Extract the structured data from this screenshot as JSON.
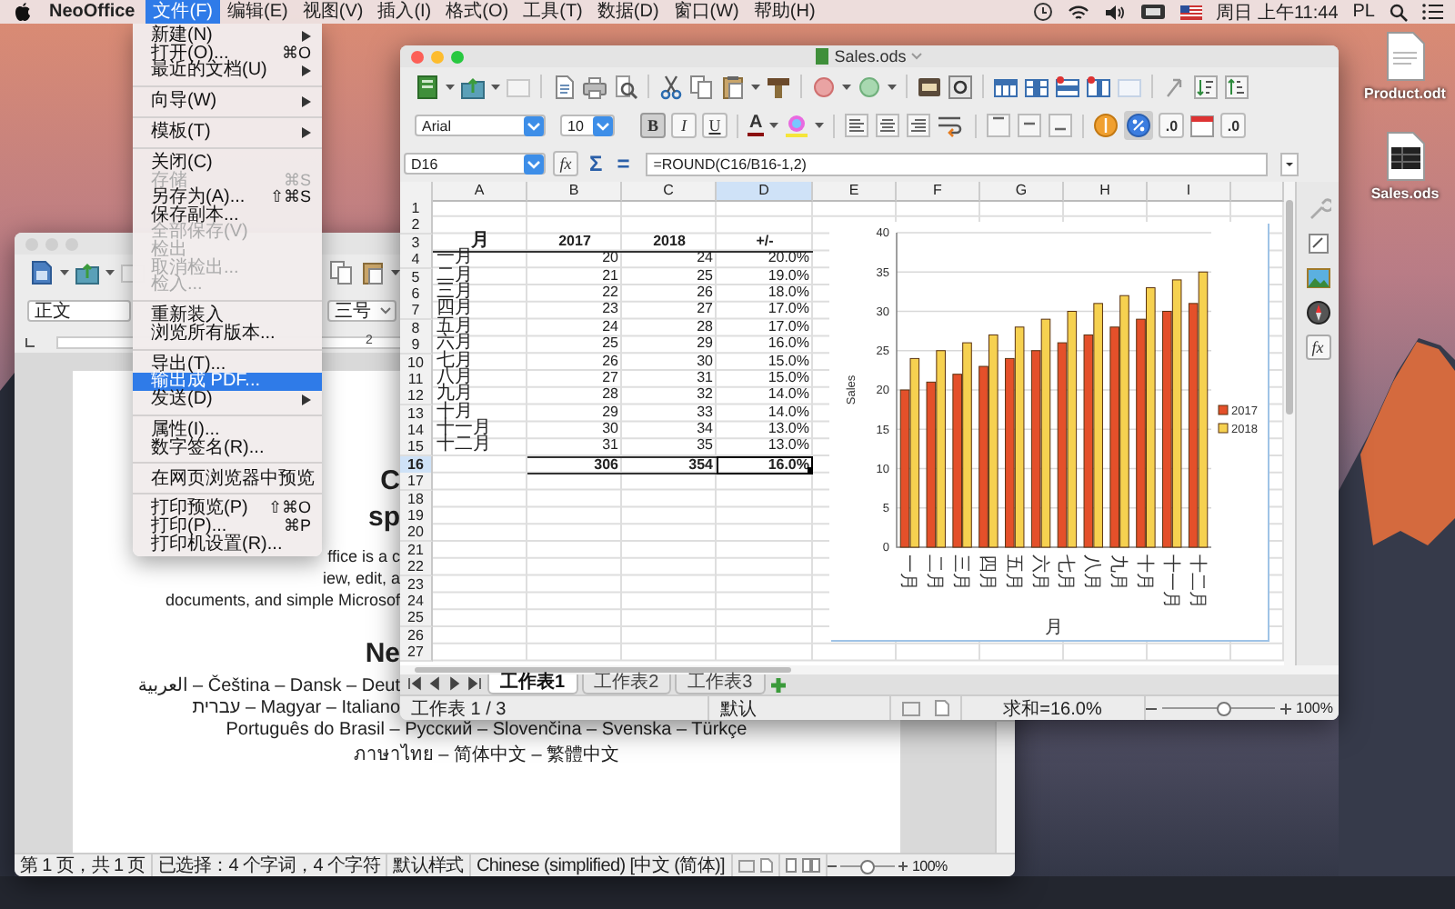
{
  "menubar": {
    "app_name": "NeoOffice",
    "menus": [
      {
        "label": "文件(F)",
        "selected": true
      },
      {
        "label": "编辑(E)",
        "selected": false
      },
      {
        "label": "视图(V)",
        "selected": false
      },
      {
        "label": "插入(I)",
        "selected": false
      },
      {
        "label": "格式(O)",
        "selected": false
      },
      {
        "label": "工具(T)",
        "selected": false
      },
      {
        "label": "数据(D)",
        "selected": false
      },
      {
        "label": "窗口(W)",
        "selected": false
      },
      {
        "label": "帮助(H)",
        "selected": false
      }
    ],
    "clock": "周日 上午11:44",
    "input_source": "PL"
  },
  "desktop_icons": [
    {
      "label": "Product.odt",
      "kind": "document"
    },
    {
      "label": "Sales.ods",
      "kind": "spreadsheet"
    }
  ],
  "writer_window": {
    "paragraph_style": "正文",
    "font_size": "三号",
    "ruler_label": "2",
    "page_lines": [
      {
        "kind": "heading",
        "clipped": true,
        "text": "C"
      },
      {
        "kind": "heading",
        "clipped": true,
        "text": "sp"
      },
      {
        "kind": "body",
        "clipped": true,
        "text": "ffice is a c"
      },
      {
        "kind": "body",
        "clipped": true,
        "text": "iew, edit, a"
      },
      {
        "kind": "body",
        "clipped": true,
        "text": "documents, and simple Microsof"
      },
      {
        "kind": "heading",
        "clipped": true,
        "text": "Ne"
      },
      {
        "kind": "language",
        "clipped": true,
        "text": "العربية – Čeština – Dansk – Deut"
      },
      {
        "kind": "language",
        "clipped": true,
        "text": "עברית – Magyar – Italiano"
      },
      {
        "kind": "language",
        "clipped": false,
        "text": "Português do Brasil – Русский – Slovenčina – Svenska – Türkçe"
      },
      {
        "kind": "language",
        "clipped": false,
        "text": "ภาษาไทย – 简体中文 – 繁體中文"
      }
    ],
    "status_bar": {
      "page": "第 1 页，共 1 页",
      "selection": "已选择：4 个字词，4 个字符",
      "page_style": "默认样式",
      "language": "Chinese (simplified) [中文 (简体)]",
      "zoom": "100%",
      "zoom_slider": {
        "level": 0.5
      }
    }
  },
  "file_menu": {
    "groups": [
      {
        "items": [
          {
            "label": "新建(N)",
            "submenu": true,
            "disabled": false,
            "selected": false
          },
          {
            "label": "打开(O)...",
            "shortcut": "⌘O",
            "submenu": false,
            "disabled": false,
            "selected": false
          },
          {
            "label": "最近的文档(U)",
            "submenu": true,
            "disabled": false,
            "selected": false
          }
        ]
      },
      {
        "items": [
          {
            "label": "向导(W)",
            "submenu": true,
            "disabled": false,
            "selected": false
          }
        ]
      },
      {
        "items": [
          {
            "label": "模板(T)",
            "submenu": true,
            "disabled": false,
            "selected": false
          }
        ]
      },
      {
        "items": [
          {
            "label": "关闭(C)",
            "submenu": false,
            "disabled": false,
            "selected": false
          },
          {
            "label": "存储",
            "shortcut": "⌘S",
            "submenu": false,
            "disabled": true,
            "selected": false
          },
          {
            "label": "另存为(A)...",
            "shortcut": "⇧⌘S",
            "submenu": false,
            "disabled": false,
            "selected": false
          },
          {
            "label": "保存副本...",
            "submenu": false,
            "disabled": false,
            "selected": false
          },
          {
            "label": "全部保存(V)",
            "submenu": false,
            "disabled": true,
            "selected": false
          },
          {
            "label": "检出",
            "submenu": false,
            "disabled": true,
            "selected": false
          },
          {
            "label": "取消检出...",
            "submenu": false,
            "disabled": true,
            "selected": false
          },
          {
            "label": "检入...",
            "submenu": false,
            "disabled": true,
            "selected": false
          }
        ]
      },
      {
        "items": [
          {
            "label": "重新装入",
            "submenu": false,
            "disabled": false,
            "selected": false
          },
          {
            "label": "浏览所有版本...",
            "submenu": false,
            "disabled": false,
            "selected": false
          }
        ]
      },
      {
        "items": [
          {
            "label": "导出(T)...",
            "submenu": false,
            "disabled": false,
            "selected": false
          },
          {
            "label": "输出成 PDF...",
            "submenu": false,
            "disabled": false,
            "selected": true
          },
          {
            "label": "发送(D)",
            "submenu": true,
            "disabled": false,
            "selected": false
          }
        ]
      },
      {
        "items": [
          {
            "label": "属性(I)...",
            "submenu": false,
            "disabled": false,
            "selected": false
          },
          {
            "label": "数字签名(R)...",
            "submenu": false,
            "disabled": false,
            "selected": false
          }
        ]
      },
      {
        "items": [
          {
            "label": "在网页浏览器中预览",
            "submenu": false,
            "disabled": false,
            "selected": false
          }
        ]
      },
      {
        "items": [
          {
            "label": "打印预览(P)",
            "shortcut": "⇧⌘O",
            "submenu": false,
            "disabled": false,
            "selected": false
          },
          {
            "label": "打印(P)...",
            "shortcut": "⌘P",
            "submenu": false,
            "disabled": false,
            "selected": false
          },
          {
            "label": "打印机设置(R)...",
            "submenu": false,
            "disabled": false,
            "selected": false
          }
        ]
      }
    ]
  },
  "spreadsheet_window": {
    "title": "Sales.ods",
    "font_name": "Arial",
    "font_size": "10",
    "format_buttons": [
      {
        "label": "B",
        "kind": "bold",
        "on": true
      },
      {
        "label": "I",
        "kind": "italic",
        "on": false
      },
      {
        "label": "U",
        "kind": "underline",
        "on": false
      }
    ],
    "font_color_label": "A",
    "percent_format_on": true,
    "add_decimal_label": ".0",
    "delete_decimal_label": ".0",
    "name_box": "D16",
    "function_wizard_label": "fx",
    "sum_label": "Σ",
    "equals_label": "=",
    "formula": "=ROUND(C16/B16-1,2)",
    "columns": [
      {
        "label": "A",
        "selected": false
      },
      {
        "label": "B",
        "selected": false
      },
      {
        "label": "C",
        "selected": false
      },
      {
        "label": "D",
        "selected": true
      },
      {
        "label": "E",
        "selected": false
      },
      {
        "label": "F",
        "selected": false
      },
      {
        "label": "G",
        "selected": false
      },
      {
        "label": "H",
        "selected": false
      },
      {
        "label": "I",
        "selected": false
      }
    ],
    "rows": [
      {
        "number": "1",
        "selected": false
      },
      {
        "number": "2",
        "selected": false
      },
      {
        "number": "3",
        "kind": "header",
        "selected": false,
        "a": {
          "text": "月",
          "selected": false
        },
        "b": {
          "text": "2017",
          "selected": false
        },
        "c": {
          "text": "2018",
          "selected": false
        },
        "d": {
          "text": "+/-",
          "selected": false
        }
      },
      {
        "number": "4",
        "kind": "data",
        "selected": false,
        "a": {
          "text": "一月",
          "selected": false
        },
        "b": {
          "text": "20",
          "selected": false
        },
        "c": {
          "text": "24",
          "selected": false
        },
        "d": {
          "text": "20.0%",
          "selected": false
        }
      },
      {
        "number": "5",
        "kind": "data",
        "selected": false,
        "a": {
          "text": "二月",
          "selected": false
        },
        "b": {
          "text": "21",
          "selected": false
        },
        "c": {
          "text": "25",
          "selected": false
        },
        "d": {
          "text": "19.0%",
          "selected": false
        }
      },
      {
        "number": "6",
        "kind": "data",
        "selected": false,
        "a": {
          "text": "三月",
          "selected": false
        },
        "b": {
          "text": "22",
          "selected": false
        },
        "c": {
          "text": "26",
          "selected": false
        },
        "d": {
          "text": "18.0%",
          "selected": false
        }
      },
      {
        "number": "7",
        "kind": "data",
        "selected": false,
        "a": {
          "text": "四月",
          "selected": false
        },
        "b": {
          "text": "23",
          "selected": false
        },
        "c": {
          "text": "27",
          "selected": false
        },
        "d": {
          "text": "17.0%",
          "selected": false
        }
      },
      {
        "number": "8",
        "kind": "data",
        "selected": false,
        "a": {
          "text": "五月",
          "selected": false
        },
        "b": {
          "text": "24",
          "selected": false
        },
        "c": {
          "text": "28",
          "selected": false
        },
        "d": {
          "text": "17.0%",
          "selected": false
        }
      },
      {
        "number": "9",
        "kind": "data",
        "selected": false,
        "a": {
          "text": "六月",
          "selected": false
        },
        "b": {
          "text": "25",
          "selected": false
        },
        "c": {
          "text": "29",
          "selected": false
        },
        "d": {
          "text": "16.0%",
          "selected": false
        }
      },
      {
        "number": "10",
        "kind": "data",
        "selected": false,
        "a": {
          "text": "七月",
          "selected": false
        },
        "b": {
          "text": "26",
          "selected": false
        },
        "c": {
          "text": "30",
          "selected": false
        },
        "d": {
          "text": "15.0%",
          "selected": false
        }
      },
      {
        "number": "11",
        "kind": "data",
        "selected": false,
        "a": {
          "text": "八月",
          "selected": false
        },
        "b": {
          "text": "27",
          "selected": false
        },
        "c": {
          "text": "31",
          "selected": false
        },
        "d": {
          "text": "15.0%",
          "selected": false
        }
      },
      {
        "number": "12",
        "kind": "data",
        "selected": false,
        "a": {
          "text": "九月",
          "selected": false
        },
        "b": {
          "text": "28",
          "selected": false
        },
        "c": {
          "text": "32",
          "selected": false
        },
        "d": {
          "text": "14.0%",
          "selected": false
        }
      },
      {
        "number": "13",
        "kind": "data",
        "selected": false,
        "a": {
          "text": "十月",
          "selected": false
        },
        "b": {
          "text": "29",
          "selected": false
        },
        "c": {
          "text": "33",
          "selected": false
        },
        "d": {
          "text": "14.0%",
          "selected": false
        }
      },
      {
        "number": "14",
        "kind": "data",
        "selected": false,
        "a": {
          "text": "十一月",
          "selected": false
        },
        "b": {
          "text": "30",
          "selected": false
        },
        "c": {
          "text": "34",
          "selected": false
        },
        "d": {
          "text": "13.0%",
          "selected": false
        }
      },
      {
        "number": "15",
        "kind": "data",
        "selected": false,
        "a": {
          "text": "十二月",
          "selected": false
        },
        "b": {
          "text": "31",
          "selected": false
        },
        "c": {
          "text": "35",
          "selected": false
        },
        "d": {
          "text": "13.0%",
          "selected": false
        }
      },
      {
        "number": "16",
        "kind": "total",
        "selected": true,
        "b": {
          "text": "306",
          "selected": false
        },
        "c": {
          "text": "354",
          "selected": false
        },
        "d": {
          "text": "16.0%",
          "selected": true
        }
      },
      {
        "number": "17",
        "selected": false
      },
      {
        "number": "18",
        "selected": false
      },
      {
        "number": "19",
        "selected": false
      },
      {
        "number": "20",
        "selected": false
      },
      {
        "number": "21",
        "selected": false
      },
      {
        "number": "22",
        "selected": false
      },
      {
        "number": "23",
        "selected": false
      },
      {
        "number": "24",
        "selected": false
      },
      {
        "number": "25",
        "selected": false
      },
      {
        "number": "26",
        "selected": false
      },
      {
        "number": "27",
        "selected": false
      }
    ],
    "chart": {
      "chart_data": {
        "type": "bar",
        "xlabel": "月",
        "ylabel": "Sales",
        "categories": [
          "一月",
          "二月",
          "三月",
          "四月",
          "五月",
          "六月",
          "七月",
          "八月",
          "九月",
          "十月",
          "十一月",
          "十二月"
        ],
        "series": [
          {
            "name": "2017",
            "color": "#e4502a",
            "values": [
              20,
              21,
              22,
              23,
              24,
              25,
              26,
              27,
              28,
              29,
              30,
              31
            ]
          },
          {
            "name": "2018",
            "color": "#f6d150",
            "values": [
              24,
              25,
              26,
              27,
              28,
              29,
              30,
              31,
              32,
              33,
              34,
              35
            ]
          }
        ],
        "ylim": [
          0,
          40
        ],
        "yticks": [
          0,
          5,
          10,
          15,
          20,
          25,
          30,
          35,
          40
        ],
        "grid": true,
        "legend": "right"
      }
    },
    "sidebar": {
      "function_label": "fx"
    },
    "sheet_tabs": [
      {
        "label": "工作表1",
        "selected": true
      },
      {
        "label": "工作表2",
        "selected": false
      },
      {
        "label": "工作表3",
        "selected": false
      }
    ],
    "status_bar": {
      "sheet": "工作表 1 / 3",
      "page_style": "默认",
      "sum": "求和=16.0%",
      "zoom": "100%",
      "zoom_slider": {
        "level": 0.55
      }
    }
  }
}
